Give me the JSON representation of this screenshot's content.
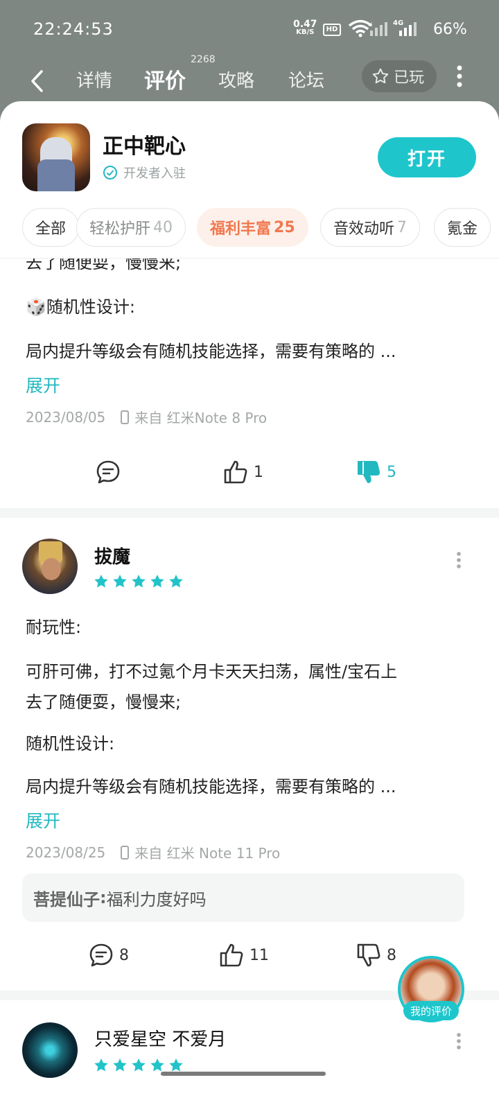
{
  "status_bar": {
    "time": "22:24:53",
    "net_speed_value": "0.47",
    "net_speed_unit": "KB/S",
    "hd_badge": "HD",
    "network_type": "4G",
    "battery": "66%"
  },
  "nav": {
    "tabs": [
      {
        "label": "详情"
      },
      {
        "label": "评价",
        "count": "2268"
      },
      {
        "label": "攻略"
      },
      {
        "label": "论坛"
      }
    ],
    "played_label": "已玩"
  },
  "game": {
    "title": "正中靶心",
    "verified_label": "开发者入驻",
    "open_label": "打开"
  },
  "tags": [
    {
      "label": "全部",
      "count": ""
    },
    {
      "label": "轻松护肝",
      "count": "40"
    },
    {
      "label": "福利丰富",
      "count": "25"
    },
    {
      "label": "音效动听",
      "count": "7"
    },
    {
      "label": "氪金",
      "count": ""
    }
  ],
  "review_prev": {
    "lines": [
      "去了随便耍，慢慢来;",
      "🎲随机性设计:",
      "局内提升等级会有随机技能选择，需要有策略的 ..."
    ],
    "expand_label": "展开",
    "date": "2023/08/05",
    "device": "来自 红米Note 8 Pro",
    "likes": "1",
    "dislikes": "5"
  },
  "review_main": {
    "user": "拔魔",
    "rating": 5,
    "lines": [
      "耐玩性:",
      "可肝可佛，打不过氪个月卡天天扫荡，属性/宝石上",
      "去了随便耍，慢慢来;",
      "随机性设计:",
      "局内提升等级会有随机技能选择，需要有策略的 ..."
    ],
    "expand_label": "展开",
    "date": "2023/08/25",
    "device": "来自 红米 Note 11 Pro",
    "reply_user": "菩提仙子",
    "reply_sep": " : ",
    "reply_text": "福利力度好吗",
    "comments": "8",
    "likes": "11",
    "dislikes": "8"
  },
  "review_next": {
    "user": "只爱星空 不爱月",
    "rating": 5
  },
  "my_review_label": "我的评价",
  "colors": {
    "accent": "#1ec6cc",
    "tag_active": "#f0784e",
    "nav_bg": "#7f8783"
  }
}
